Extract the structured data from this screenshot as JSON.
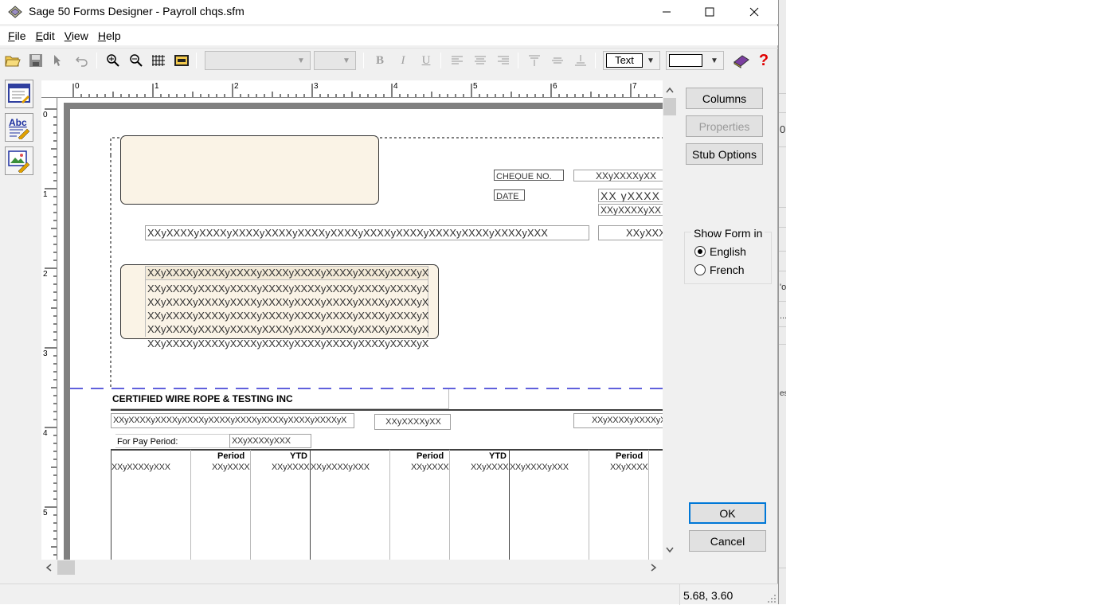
{
  "window": {
    "title": "Sage 50 Forms Designer - Payroll chqs.sfm"
  },
  "menu": [
    "File",
    "Edit",
    "View",
    "Help"
  ],
  "toolbar": {
    "text_button": "Text"
  },
  "ruler": {
    "h_marks": [
      "0",
      "1",
      "2",
      "3",
      "4",
      "5",
      "6",
      "7"
    ],
    "v_marks": [
      "0",
      "1",
      "2",
      "3",
      "4",
      "5"
    ]
  },
  "form": {
    "cheque_no_label": "CHEQUE NO.",
    "date_label": "DATE",
    "cheque_no_value": "XXyXXXXyXX",
    "date_value": "XX yXXXX",
    "date_value2": "XXyXXXXyXX",
    "amount_words": "XXyXXXXyXXXXyXXXXyXXXXyXXXXyXXXXyXXXXyXXXXyXXXXyXXXXyXXXXyXXX",
    "amount_value": "XXyXXXXyXX",
    "payee_lines": [
      "XXyXXXXyXXXXyXXXXyXXXXyXXXXyXXXXyXXXXyXXXXyX",
      "XXyXXXXyXXXXyXXXXyXXXXyXXXXyXXXXyXXXXyXXXXyX",
      "XXyXXXXyXXXXyXXXXyXXXXyXXXXyXXXXyXXXXyXXXXyX",
      "XXyXXXXyXXXXyXXXXyXXXXyXXXXyXXXXyXXXXyXXXXyX",
      "XXyXXXXyXXXXyXXXXyXXXXyXXXXyXXXXyXXXXyXXXXyX",
      "XXyXXXXyXXXXyXXXXyXXXXyXXXXyXXXXyXXXXyXXXXyX"
    ],
    "company": "CERTIFIED WIRE ROPE & TESTING INC",
    "stub_field1": "XXyXXXXyXXXXyXXXXyXXXXyXXXXyXXXXyXXXXyXXXXyX",
    "stub_field2": "XXyXXXXyXX",
    "stub_field3": "XXyXXXXyXXXXyX",
    "pay_period_label": "For Pay Period:",
    "pay_period_value": "XXyXXXXyXXX",
    "col_period": "Period",
    "col_ytd": "YTD",
    "col_name": "XXyXXXXyXXX",
    "col_val": "XXyXXXX"
  },
  "buttons": {
    "columns": "Columns",
    "properties": "Properties",
    "stub_options": "Stub Options",
    "ok": "OK",
    "cancel": "Cancel"
  },
  "show_form": {
    "legend": "Show Form in",
    "english": "English",
    "french": "French",
    "selected": "English"
  },
  "status": {
    "coords": "5.68, 3.60"
  },
  "bg_app": {
    "chars": [
      "0",
      "'o",
      "...",
      "es"
    ]
  }
}
